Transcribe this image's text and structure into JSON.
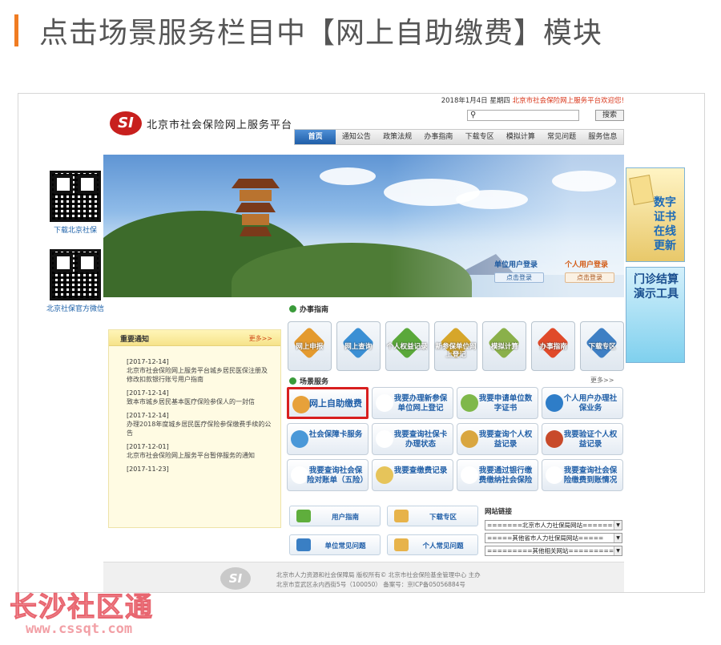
{
  "article": {
    "title": "点击场景服务栏目中【网上自助缴费】模块"
  },
  "qr": [
    {
      "label": "下载北京社保"
    },
    {
      "label": "北京社保官方微信"
    }
  ],
  "portal": {
    "date_text": "2018年1月4日 星期四",
    "welcome": "北京市社会保险网上服务平台欢迎您!",
    "search_button": "搜索",
    "logo_mark": "SI",
    "site_name": "北京市社会保险网上服务平台",
    "nav": [
      "首页",
      "通知公告",
      "政策法规",
      "办事指南",
      "下载专区",
      "模拟计算",
      "常见问题",
      "服务信息"
    ],
    "login": {
      "unit_label": "单位用户登录",
      "unit_button": "点击登录",
      "personal_label": "个人用户登录",
      "personal_button": "点击登录"
    },
    "notice": {
      "title": "重要通知",
      "more": "更多>>",
      "items": [
        {
          "date": "[2017-12-14]",
          "text": "北京市社会保险网上服务平台城乡居民医保注册及修改扣款银行账号用户指南"
        },
        {
          "date": "[2017-12-14]",
          "text": "致本市城乡居民基本医疗保险参保人的一封信"
        },
        {
          "date": "[2017-12-14]",
          "text": "办理2018年度城乡居民医疗保险参保缴费手续的公告"
        },
        {
          "date": "[2017-12-01]",
          "text": "北京市社会保险网上服务平台暂停服务的通知"
        },
        {
          "date": "[2017-11-23]",
          "text": ""
        }
      ]
    },
    "guide": {
      "title": "办事指南",
      "items": [
        {
          "label": "网上申报",
          "color": "#e49a2e"
        },
        {
          "label": "网上查询",
          "color": "#3a8fd4"
        },
        {
          "label": "个人权益记录",
          "color": "#5aa83a"
        },
        {
          "label": "新参保单位网上登记",
          "color": "#d6a62a"
        },
        {
          "label": "模拟计算",
          "color": "#8ab04a"
        },
        {
          "label": "办事指南",
          "color": "#e04a2a"
        },
        {
          "label": "下载专区",
          "color": "#3e7fc4"
        }
      ]
    },
    "services": {
      "title": "场景服务",
      "more": "更多>>",
      "items": [
        {
          "label": "网上自助缴费",
          "icon": "#e7a13a",
          "highlight": true
        },
        {
          "label": "我要办理新参保单位网上登记",
          "icon": "#ffffff"
        },
        {
          "label": "我要申请单位数字证书",
          "icon": "#7fb84a"
        },
        {
          "label": "个人用户办理社保业务",
          "icon": "#2e7dc8"
        },
        {
          "label": "社会保障卡服务",
          "icon": "#4a98d8"
        },
        {
          "label": "我要查询社保卡办理状态",
          "icon": "#ffffff"
        },
        {
          "label": "我要查询个人权益记录",
          "icon": "#d9a640"
        },
        {
          "label": "我要验证个人权益记录",
          "icon": "#c84a2a"
        },
        {
          "label": "我要查询社会保险对账单（五险）",
          "icon": "#ffffff"
        },
        {
          "label": "我要查缴费记录",
          "icon": "#e6c45a"
        },
        {
          "label": "我要通过银行缴费缴纳社会保险",
          "icon": "#ffffff"
        },
        {
          "label": "我要查询社会保险缴费到账情况",
          "icon": "#ffffff"
        }
      ]
    },
    "bottom": {
      "user_guide": "用户指南",
      "downloads": "下载专区",
      "unit_faq": "单位常见问题",
      "personal_faq": "个人常见问题",
      "links_title": "网站链接",
      "links": [
        "=======北京市人力社保局网站=======",
        "=====其他省市人力社保局网站=====",
        "=========其他相关网站=========="
      ]
    },
    "footer": {
      "line1": "北京市人力资源和社会保障局  版权所有© 北京市社会保险基金管理中心 主办",
      "line2": "北京市宣武区永内西街5号（100050）  备案号：京ICP备05056884号"
    }
  },
  "ads": {
    "cert": "数字证书在线更新",
    "clinic": "门诊结算演示工具"
  },
  "watermark": {
    "name": "长沙社区通",
    "url": "www.cssqt.com"
  }
}
